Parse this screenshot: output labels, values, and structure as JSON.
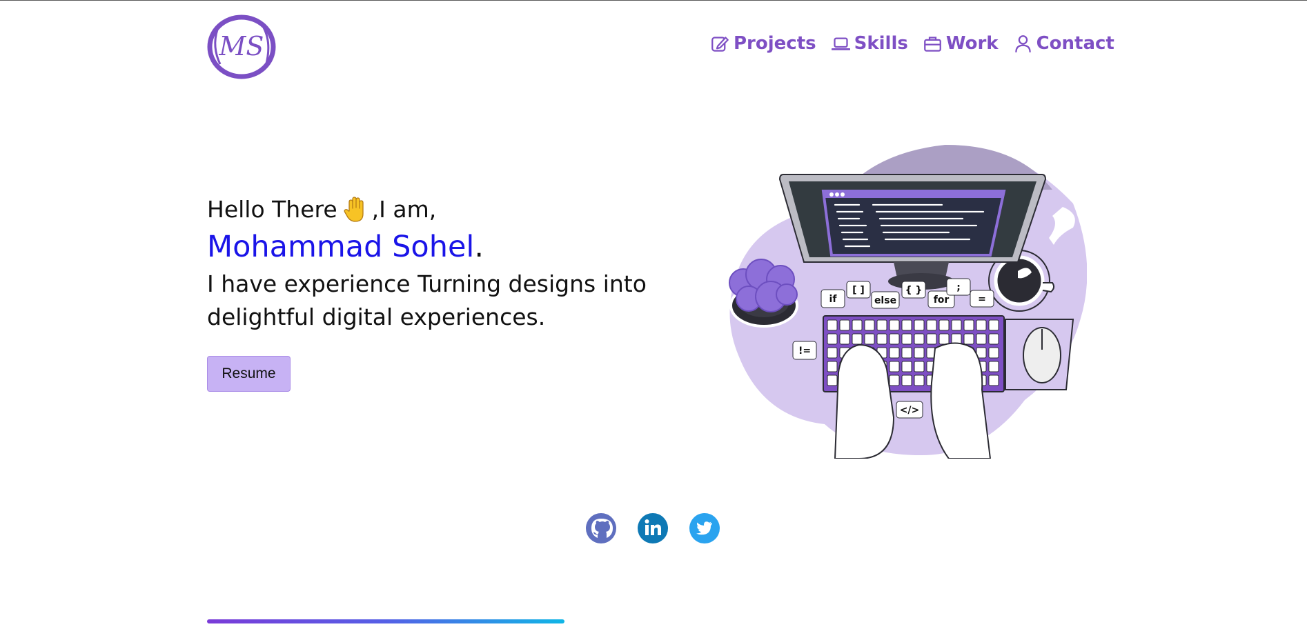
{
  "logo": {
    "text": "MS"
  },
  "nav": {
    "items": [
      {
        "label": "Projects",
        "icon": "edit-icon"
      },
      {
        "label": "Skills",
        "icon": "laptop-icon"
      },
      {
        "label": "Work",
        "icon": "briefcase-icon"
      },
      {
        "label": "Contact",
        "icon": "user-icon"
      }
    ]
  },
  "hero": {
    "greeting_before": "Hello There ",
    "greeting_after": ",I am,",
    "name": "Mohammad Sohel",
    "name_dot": ".",
    "description": "I have experience Turning designs into delightful digital experiences.",
    "resume_label": "Resume"
  },
  "illustration": {
    "bubbles": [
      "if",
      "[ ]",
      "else",
      "{ }",
      "for",
      ";",
      "=",
      "!=",
      "</>"
    ]
  },
  "socials": [
    {
      "name": "github",
      "icon": "github-icon"
    },
    {
      "name": "linkedin",
      "icon": "linkedin-icon"
    },
    {
      "name": "twitter",
      "icon": "twitter-icon"
    }
  ],
  "colors": {
    "accent": "#7e4fc4",
    "name": "#1a14e8",
    "button": "#c7b2f4"
  }
}
